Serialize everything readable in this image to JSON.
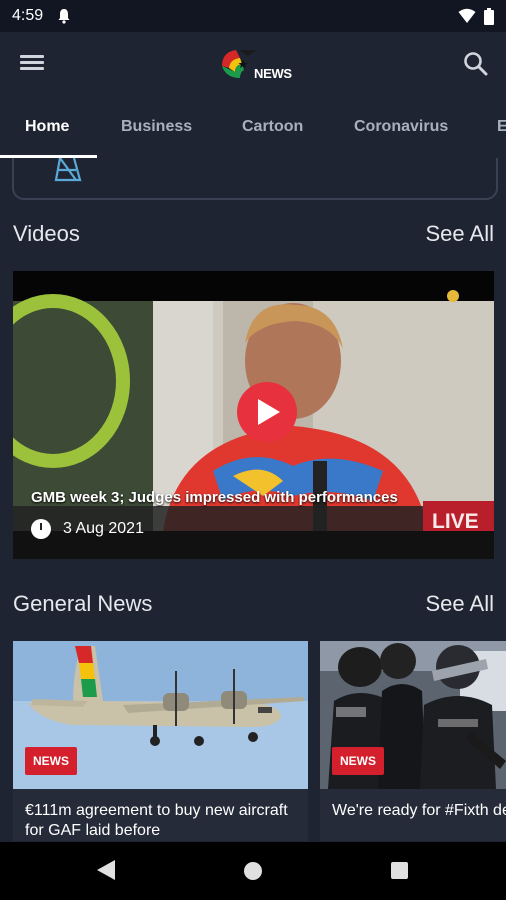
{
  "status_bar": {
    "time": "4:59"
  },
  "app": {
    "logo_text": "NEWS"
  },
  "tabs": [
    {
      "label": "Home",
      "active": true
    },
    {
      "label": "Business",
      "active": false
    },
    {
      "label": "Cartoon",
      "active": false
    },
    {
      "label": "Coronavirus",
      "active": false
    },
    {
      "label": "E",
      "active": false
    }
  ],
  "videos_section": {
    "title": "Videos",
    "see_all": "See All",
    "featured": {
      "title": "GMB week 3; Judges impressed with performances",
      "date": "3 Aug 2021",
      "overlay_text": "LIVE"
    }
  },
  "general_news_section": {
    "title": "General News",
    "see_all": "See All",
    "articles": [
      {
        "badge": "NEWS",
        "title": "€111m agreement to buy new aircraft for GAF laid before"
      },
      {
        "badge": "NEWS",
        "title": "We're ready for #Fixth demo – Police"
      }
    ]
  },
  "colors": {
    "background": "#1e2432",
    "status_bar": "#111622",
    "accent_red": "#e8313f",
    "badge_red": "#d4202c"
  },
  "icons": {
    "menu": "hamburger-icon",
    "search": "search-icon",
    "play": "play-icon",
    "clock": "clock-icon",
    "nav_back": "back-triangle-icon",
    "nav_home": "home-circle-icon",
    "nav_recent": "recent-square-icon"
  }
}
